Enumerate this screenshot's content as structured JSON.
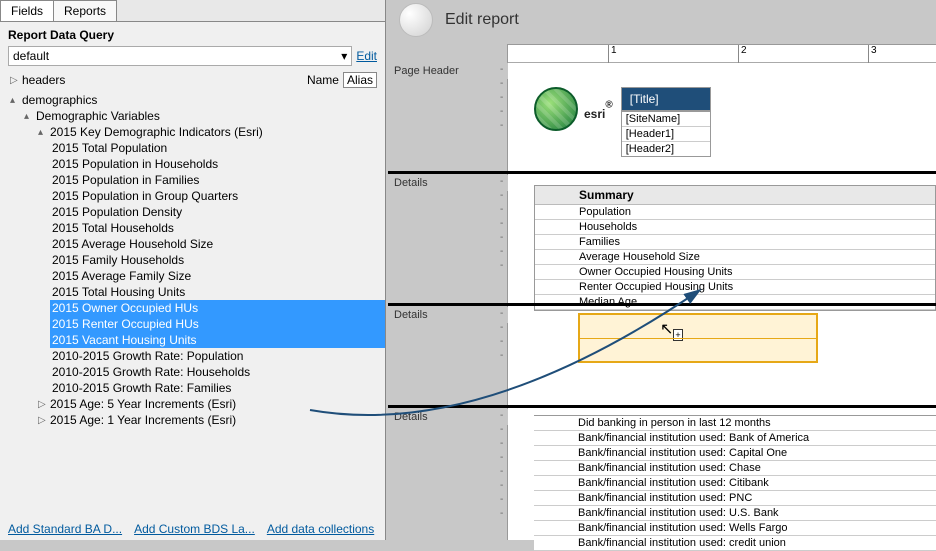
{
  "tabs": {
    "fields": "Fields",
    "reports": "Reports"
  },
  "query": {
    "label": "Report Data Query",
    "selected": "default",
    "edit": "Edit"
  },
  "headers_label": "headers",
  "name_label": "Name",
  "alias_label": "Alias",
  "tree": {
    "root": "demographics",
    "l1": "Demographic Variables",
    "l2": "2015 Key Demographic Indicators (Esri)",
    "items": [
      "2015 Total Population",
      "2015 Population in Households",
      "2015 Population in Families",
      "2015 Population in Group Quarters",
      "2015 Population Density",
      "2015 Total Households",
      "2015 Average Household Size",
      "2015 Family Households",
      "2015 Average Family Size",
      "2015 Total Housing Units",
      "2015 Owner Occupied HUs",
      "2015 Renter Occupied HUs",
      "2015 Vacant Housing Units",
      "2010-2015 Growth Rate: Population",
      "2010-2015 Growth Rate: Households",
      "2010-2015 Growth Rate: Families"
    ],
    "sub1": "2015 Age: 5 Year Increments (Esri)",
    "sub2": "2015 Age: 1 Year Increments (Esri)"
  },
  "footer": {
    "l1": "Add Standard BA D...",
    "l2": "Add Custom BDS La...",
    "l3": "Add data collections"
  },
  "title": "Edit report",
  "ruler": [
    "1",
    "2",
    "3"
  ],
  "sections": {
    "page_header": "Page Header",
    "details": "Details"
  },
  "page_header": {
    "logo_text": "esri",
    "title": "[Title]",
    "meta": [
      "[SiteName]",
      "[Header1]",
      "[Header2]"
    ]
  },
  "summary": {
    "header": "Summary",
    "rows": [
      "Population",
      "Households",
      "Families",
      "Average Household Size",
      "Owner Occupied Housing Units",
      "Renter Occupied Housing Units",
      "Median Age"
    ]
  },
  "bank_rows": [
    "Did banking in person in last 12 months",
    "Bank/financial institution used: Bank of America",
    "Bank/financial institution used: Capital One",
    "Bank/financial institution used: Chase",
    "Bank/financial institution used: Citibank",
    "Bank/financial institution used: PNC",
    "Bank/financial institution used: U.S. Bank",
    "Bank/financial institution used: Wells Fargo",
    "Bank/financial institution used: credit union"
  ]
}
